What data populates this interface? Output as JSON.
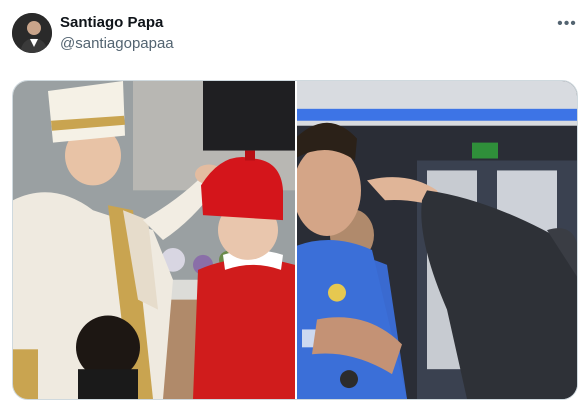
{
  "author": {
    "name": "Santiago Papa",
    "handle": "@santiagopapaa",
    "avatar_icon": "profile-photo"
  },
  "actions": {
    "more_icon": "more-horizontal-icon"
  },
  "media": {
    "photos": [
      {
        "alt": "photo-pope-placing-biretta-on-cardinal"
      },
      {
        "alt": "photo-man-touching-forehead-of-player"
      }
    ]
  },
  "colors": {
    "text_primary": "#0f1419",
    "text_secondary": "#536471",
    "border": "#cfd9de"
  }
}
